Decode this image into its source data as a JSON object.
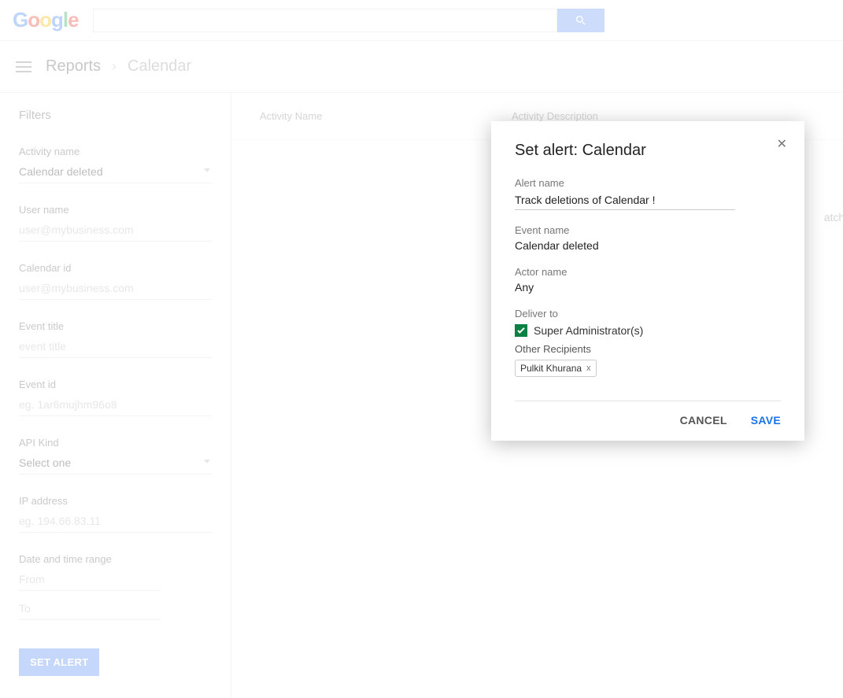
{
  "header": {
    "logo": [
      "G",
      "o",
      "o",
      "g",
      "l",
      "e"
    ],
    "search_placeholder": ""
  },
  "breadcrumb": {
    "reports": "Reports",
    "calendar": "Calendar"
  },
  "filters": {
    "title": "Filters",
    "activity_name_label": "Activity name",
    "activity_name_value": "Calendar deleted",
    "user_name_label": "User name",
    "user_name_placeholder": "user@mybusiness.com",
    "calendar_id_label": "Calendar id",
    "calendar_id_placeholder": "user@mybusiness.com",
    "event_title_label": "Event title",
    "event_title_placeholder": "event title",
    "event_id_label": "Event id",
    "event_id_placeholder": "eg. 1ar6mujhm96o8",
    "api_kind_label": "API Kind",
    "api_kind_value": "Select one",
    "ip_label": "IP address",
    "ip_placeholder": "eg. 194.66.83.11",
    "date_label": "Date and time range",
    "from_placeholder": "From",
    "to_placeholder": "To",
    "set_alert_btn": "SET ALERT"
  },
  "table": {
    "activity_name": "Activity Name",
    "activity_description": "Activity Description",
    "noresults_fragment": "atch t"
  },
  "dialog": {
    "title": "Set alert: Calendar",
    "alert_name_label": "Alert name",
    "alert_name_value": "Track deletions of Calendar !",
    "event_name_label": "Event name",
    "event_name_value": "Calendar deleted",
    "actor_name_label": "Actor name",
    "actor_name_value": "Any",
    "deliver_to_label": "Deliver to",
    "super_admin_label": "Super Administrator(s)",
    "other_recipients_label": "Other Recipients",
    "chip_name": "Pulkit Khurana",
    "cancel": "CANCEL",
    "save": "SAVE"
  }
}
